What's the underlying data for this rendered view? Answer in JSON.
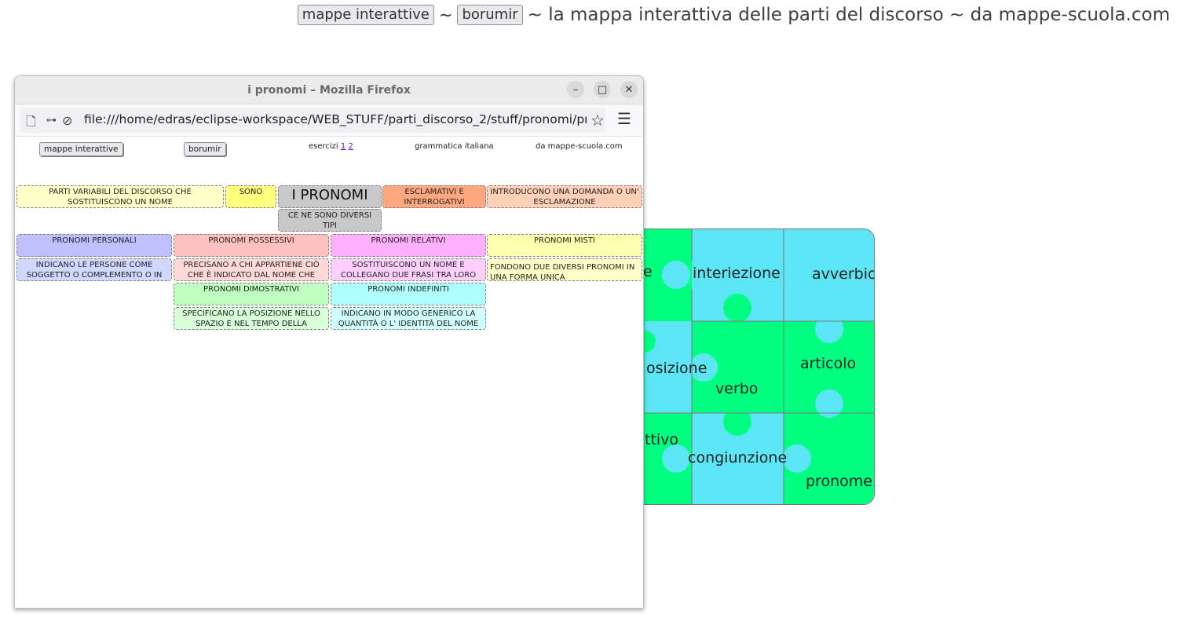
{
  "header": {
    "button_mappe": "mappe interattive",
    "sep1": "~",
    "button_borumir": "borumir",
    "tagline": "~ la mappa interattiva delle parti del discorso ~ da mappe-scuola.com"
  },
  "puzzle": {
    "colors": {
      "green": "#00ff80",
      "cyan": "#5ce6f5"
    },
    "labels": {
      "interiezione": "interiezione",
      "avverbio": "avverbio",
      "preposizione_partial": "osizione",
      "verbo": "verbo",
      "articolo": "articolo",
      "aggettivo_partial": "ttivo",
      "congiunzione": "congiunzione",
      "pronome": "pronome",
      "nome_partial": "e"
    }
  },
  "browser": {
    "title": "i pronomi – Mozilla Firefox",
    "url": "file:///home/edras/eclipse-workspace/WEB_STUFF/parti_discorso_2/stuff/pronomi/pronomi.",
    "content": {
      "btn_mappe": "mappe interattive",
      "btn_borumir": "borumir",
      "esercizi_label": "esercizi",
      "esercizi_1": "1",
      "esercizi_2": "2",
      "grammatica": "grammatica italiana",
      "da_sito": "da mappe-scuola.com",
      "boxes": {
        "parti_variabili": "PARTI VARIABILI DEL DISCORSO CHE SOSTITUISCONO UN NOME",
        "sono": "SONO",
        "i_pronomi": "I PRONOMI",
        "esclamativi": "ESCLAMATIVI E INTERROGATIVI",
        "introducono": "INTRODUCONO UNA DOMANDA O UN' ESCLAMAZIONE",
        "ce_ne_sono": "CE NE SONO DIVERSI TIPI",
        "personali": "PRONOMI PERSONALI",
        "possessivi": "PRONOMI POSSESSIVI",
        "relativi": "PRONOMI RELATIVI",
        "misti": "PRONOMI MISTI",
        "personali_desc": "INDICANO LE PERSONE COME SOGGETTO O COMPLEMENTO O IN",
        "possessivi_desc": "PRECISANO A CHI APPARTIENE CIÒ CHE È INDICATO DAL NOME CHE",
        "relativi_desc": "SOSTITUISCONO UN NOME E COLLEGANO DUE FRASI TRA LORO",
        "misti_desc": "FONDONO DUE DIVERSI PRONOMI IN UNA FORMA UNICA",
        "dimostrativi": "PRONOMI DIMOSTRATIVI",
        "indefiniti": "PRONOMI INDEFINITI",
        "dimostrativi_desc": "SPECIFICANO LA POSIZIONE NELLO SPAZIO E NEL TEMPO DELLA",
        "indefiniti_desc": "INDICANO IN MODO GENERICO LA QUANTITÀ O L' IDENTITÀ DEL NOME"
      },
      "box_colors": {
        "light_yellow": "#ffffc8",
        "yellow": "#ffff80",
        "gray": "#c8c8c8",
        "orange": "#ffa880",
        "peach": "#ffd0b8",
        "blue": "#c0c0ff",
        "light_blue": "#d0d8ff",
        "pink": "#ffc0c0",
        "light_pink": "#ffd8d8",
        "magenta": "#ffb0ff",
        "light_magenta": "#ffd0ff",
        "pale_yellow": "#ffffb0",
        "green": "#c0ffc0",
        "light_green": "#d8ffd8",
        "cyan": "#b0ffff",
        "light_cyan": "#d0ffff"
      }
    }
  }
}
